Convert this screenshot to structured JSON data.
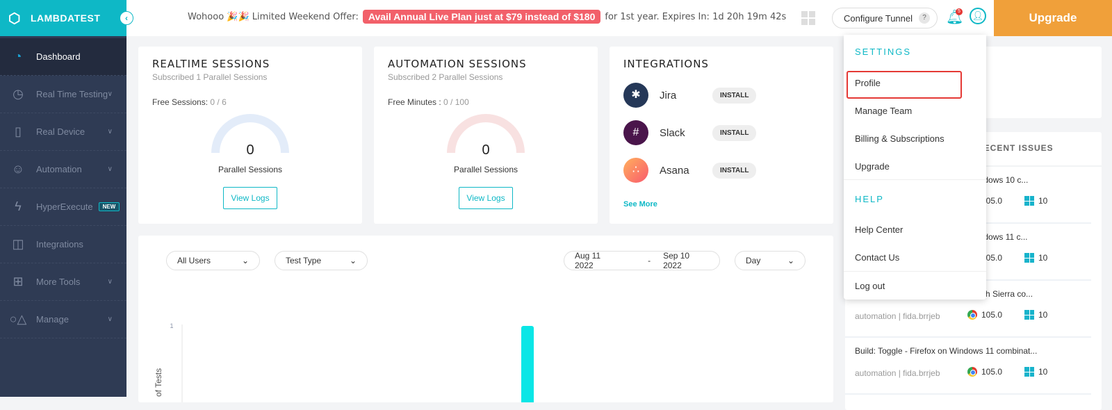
{
  "brand": {
    "name": "LAMBDATEST"
  },
  "topbar": {
    "offer_text": "Wohooo 🎉🎉 Limited Weekend Offer:",
    "offer_pill": "Avail Annual Live Plan just at $79 instead of $180",
    "offer_tail": "for 1st year. Expires In: 1d 20h 19m 42s",
    "tunnel": "Configure Tunnel",
    "tunnel_help": "?",
    "notifications": "5",
    "upgrade": "Upgrade"
  },
  "sidebar": {
    "items": [
      {
        "label": "Dashboard",
        "icon": "speedometer-icon"
      },
      {
        "label": "Real Time Testing",
        "icon": "clock-icon"
      },
      {
        "label": "Real Device",
        "icon": "phone-icon"
      },
      {
        "label": "Automation",
        "icon": "robot-icon"
      },
      {
        "label": "HyperExecute",
        "icon": "lightning-icon",
        "badge": "NEW"
      },
      {
        "label": "Integrations",
        "icon": "integrations-icon"
      },
      {
        "label": "More Tools",
        "icon": "plus-square-icon"
      },
      {
        "label": "Manage",
        "icon": "shapes-icon"
      }
    ]
  },
  "realtime": {
    "title": "REALTIME SESSIONS",
    "subtitle": "Subscribed 1 Parallel Sessions",
    "free_label": "Free Sessions:",
    "free_value": "0 / 6",
    "value": "0",
    "gauge_label": "Parallel Sessions",
    "button": "View Logs",
    "color": "#e3ecf9"
  },
  "automation": {
    "title": "AUTOMATION SESSIONS",
    "subtitle": "Subscribed 2 Parallel Sessions",
    "free_label": "Free Minutes :",
    "free_value": "0 / 100",
    "value": "0",
    "gauge_label": "Parallel Sessions",
    "button": "View Logs",
    "color": "#f8e1e1"
  },
  "integrations": {
    "title": "INTEGRATIONS",
    "items": [
      {
        "name": "Jira",
        "action": "INSTALL"
      },
      {
        "name": "Slack",
        "action": "INSTALL"
      },
      {
        "name": "Asana",
        "action": "INSTALL"
      }
    ],
    "see_more": "See More"
  },
  "filters": {
    "users": "All Users",
    "test_type": "Test Type",
    "date_from": "Aug 11 2022",
    "date_sep": "-",
    "date_to": "Sep 10 2022",
    "granularity": "Day"
  },
  "chart_data": {
    "type": "bar",
    "ylabel": "of Tests",
    "y_ticks": [
      "1"
    ],
    "ylim": [
      0,
      1
    ],
    "values": [
      1
    ],
    "color": "#0ae6e6"
  },
  "dropdown": {
    "settings_header": "SETTINGS",
    "settings": [
      "Profile",
      "Manage Team",
      "Billing & Subscriptions",
      "Upgrade"
    ],
    "help_header": "HELP",
    "help": [
      "Help Center",
      "Contact Us"
    ],
    "logout": "Log out"
  },
  "recent": {
    "title": "RECENT ISSUES",
    "issues": [
      {
        "title": "indows 10 c...",
        "meta": "",
        "browser": "105.0",
        "os": "10"
      },
      {
        "title": "indows 11 c...",
        "meta": "",
        "browser": "105.0",
        "os": "10"
      },
      {
        "title": "ligh Sierra co...",
        "meta": "automation | fida.brrjeb",
        "browser": "105.0",
        "os": "10"
      },
      {
        "title": "Build: Toggle - Firefox on Windows 11 combinat...",
        "meta": "automation | fida.brrjeb",
        "browser": "105.0",
        "os": "10"
      }
    ]
  }
}
